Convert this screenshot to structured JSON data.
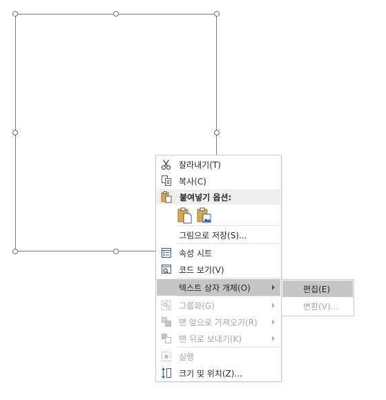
{
  "menu": {
    "cut": "잘라내기(T)",
    "copy": "복사(C)",
    "paste_options": "붙여넣기 옵션:",
    "paste_icon_1": "paste-keep-source-icon",
    "paste_icon_2": "paste-picture-icon",
    "save_as_picture": "그림으로 저장(S)...",
    "property_sheet": "속성 시트",
    "view_code": "코드 보기(V)",
    "textbox_object": "텍스트 상자 개체(O)",
    "group": "그룹화(G)",
    "bring_to_front": "맨 앞으로 가져오기(R)",
    "send_to_back": "맨 뒤로 보내기(K)",
    "run": "실행",
    "size_position": "크기 및 위치(Z)..."
  },
  "submenu": {
    "edit": "편집(E)",
    "convert": "변환(V)..."
  },
  "colors": {
    "highlight": "#c6c6c6",
    "disabled_text": "#a6a6a6",
    "icon_blue": "#2b5797",
    "icon_gold": "#d9a84e"
  }
}
